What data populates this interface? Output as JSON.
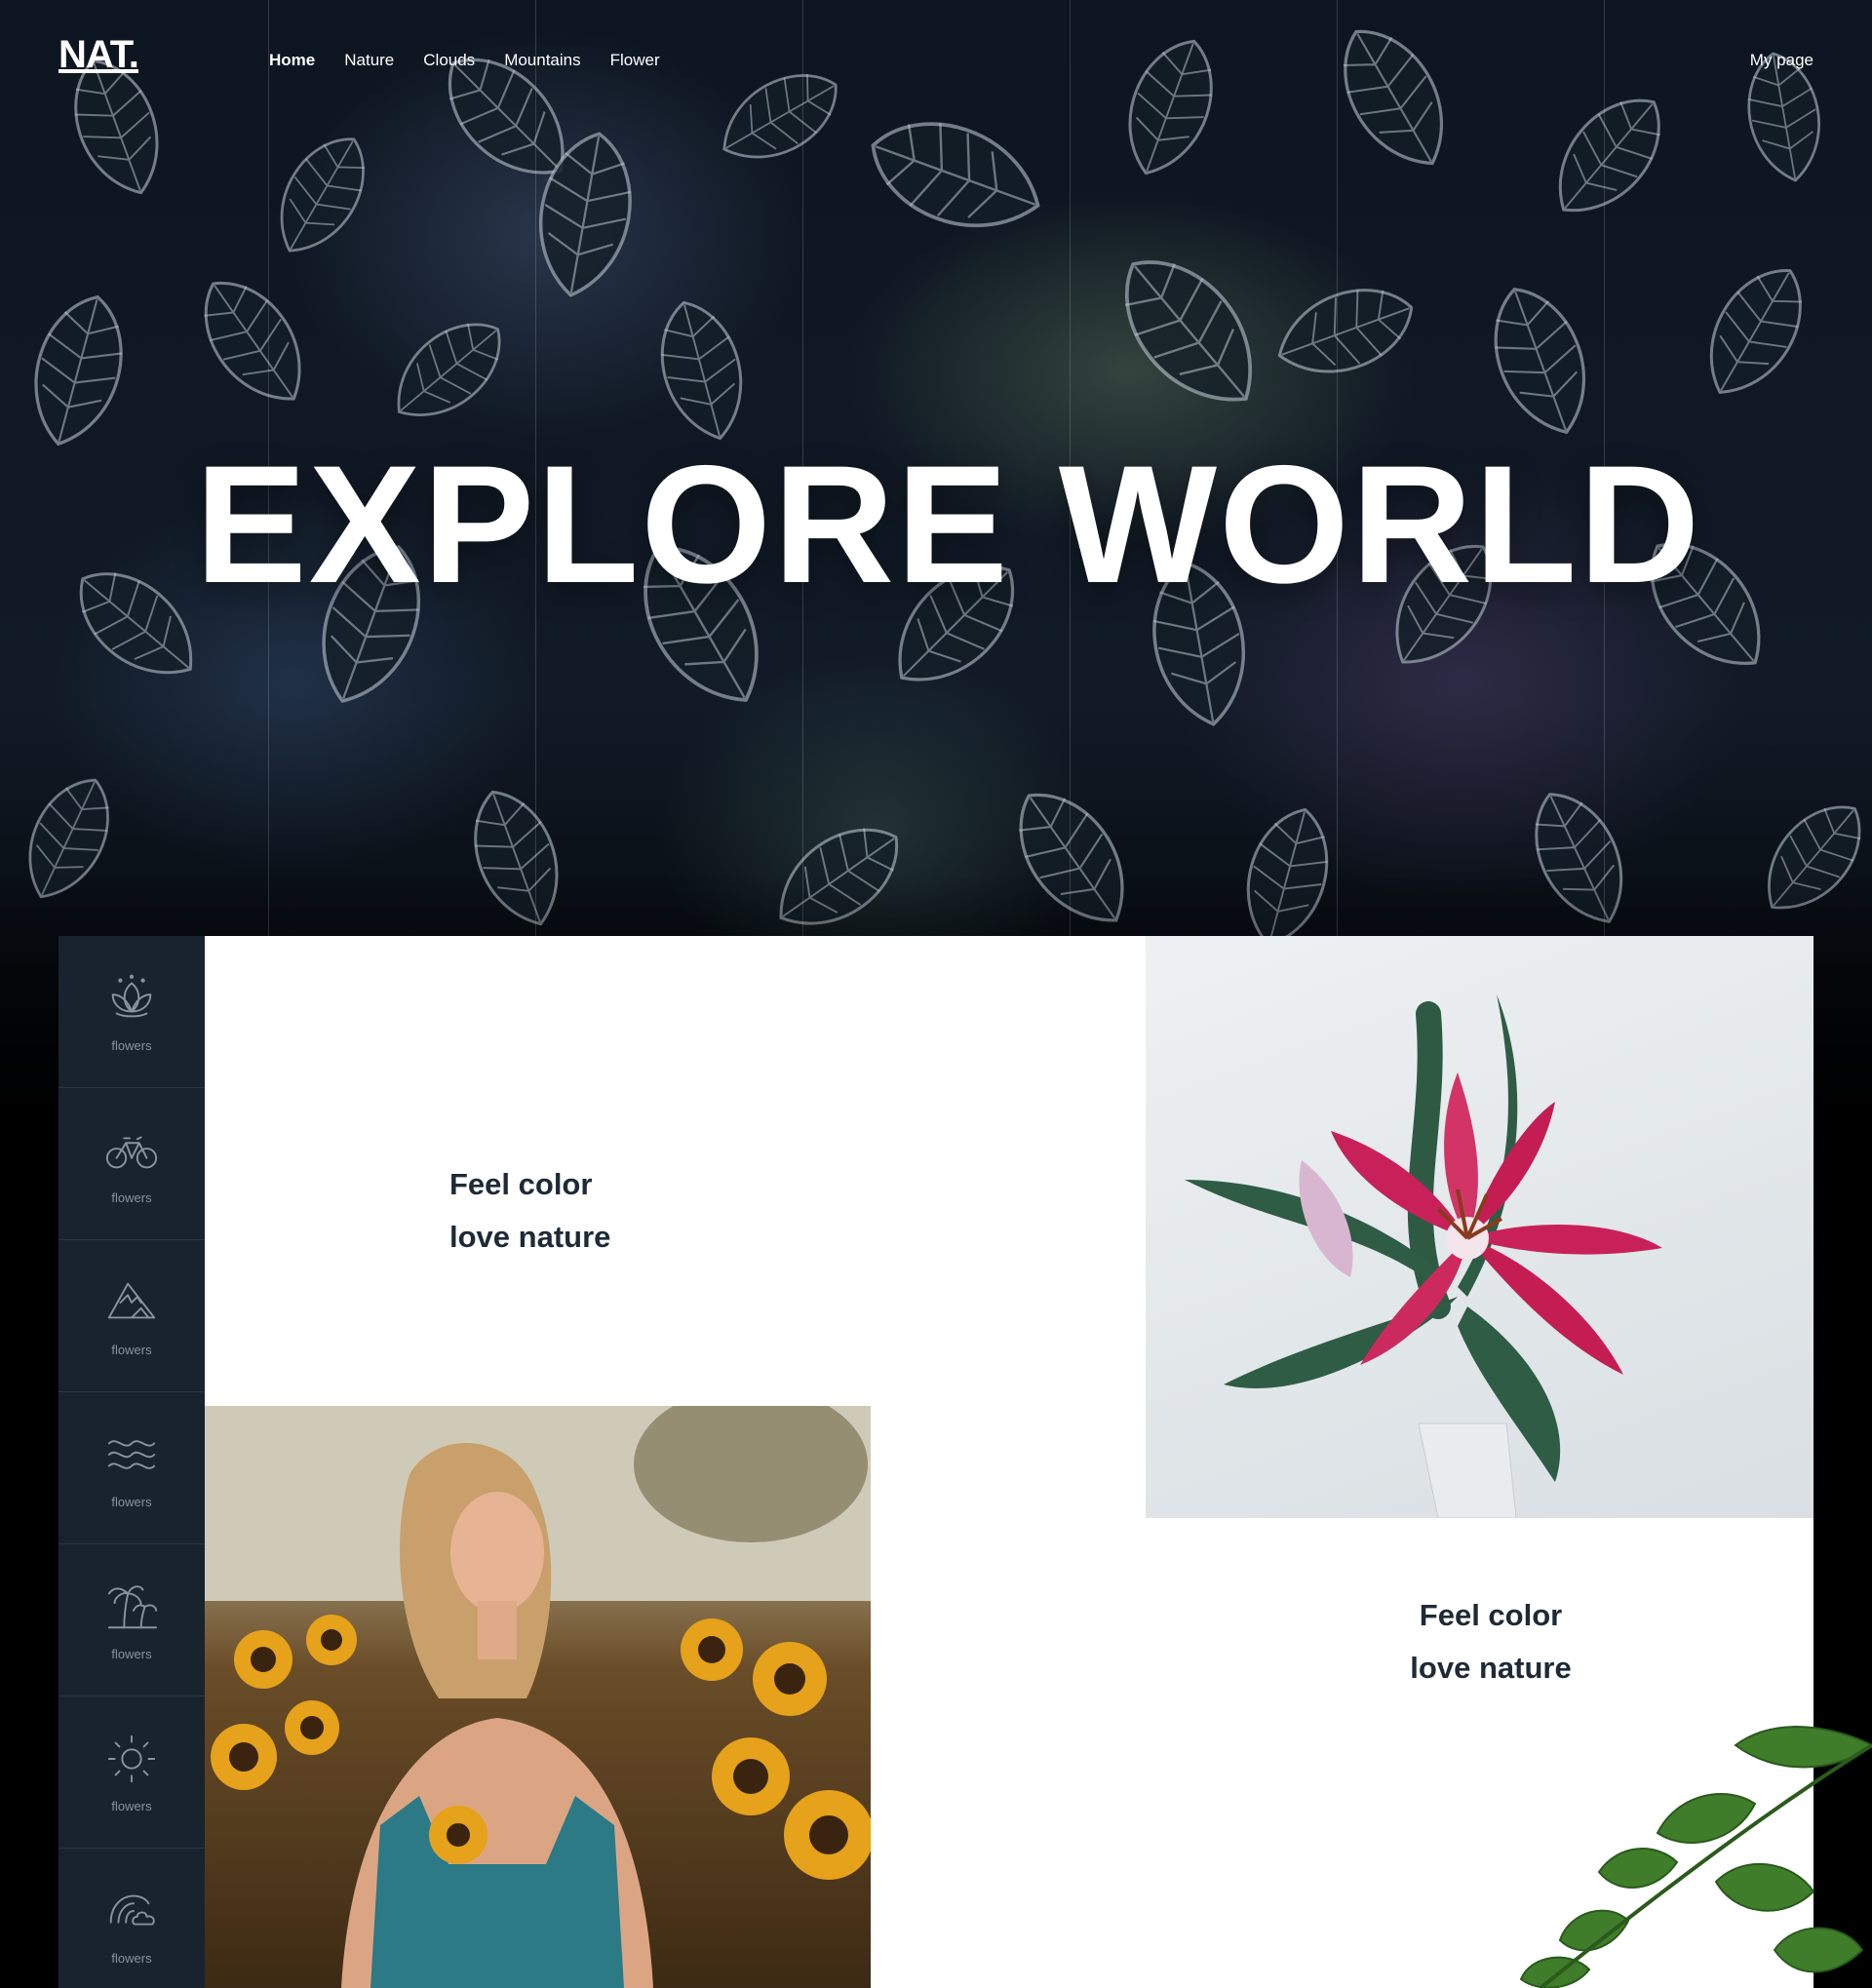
{
  "brand": {
    "logo": "NAT."
  },
  "nav": {
    "items": [
      {
        "label": "Home",
        "active": true
      },
      {
        "label": "Nature",
        "active": false
      },
      {
        "label": "Clouds",
        "active": false
      },
      {
        "label": "Mountains",
        "active": false
      },
      {
        "label": "Flower",
        "active": false
      }
    ],
    "account_label": "My page"
  },
  "hero": {
    "headline": "EXPLORE WORLD"
  },
  "sidebar": {
    "items": [
      {
        "icon": "lotus-icon",
        "label": "flowers"
      },
      {
        "icon": "bicycle-icon",
        "label": "flowers"
      },
      {
        "icon": "mountain-icon",
        "label": "flowers"
      },
      {
        "icon": "waves-icon",
        "label": "flowers"
      },
      {
        "icon": "palm-tree-icon",
        "label": "flowers"
      },
      {
        "icon": "sun-icon",
        "label": "flowers"
      },
      {
        "icon": "rainbow-cloud-icon",
        "label": "flowers"
      }
    ]
  },
  "content": {
    "taglines": [
      {
        "line1": "Feel color",
        "line2": "love nature"
      },
      {
        "line1": "Feel color",
        "line2": "love nature"
      }
    ]
  },
  "colors": {
    "sidebar_bg": "#18232e",
    "text_dark": "#1e2a36",
    "sidebar_icon": "#8a939b"
  }
}
